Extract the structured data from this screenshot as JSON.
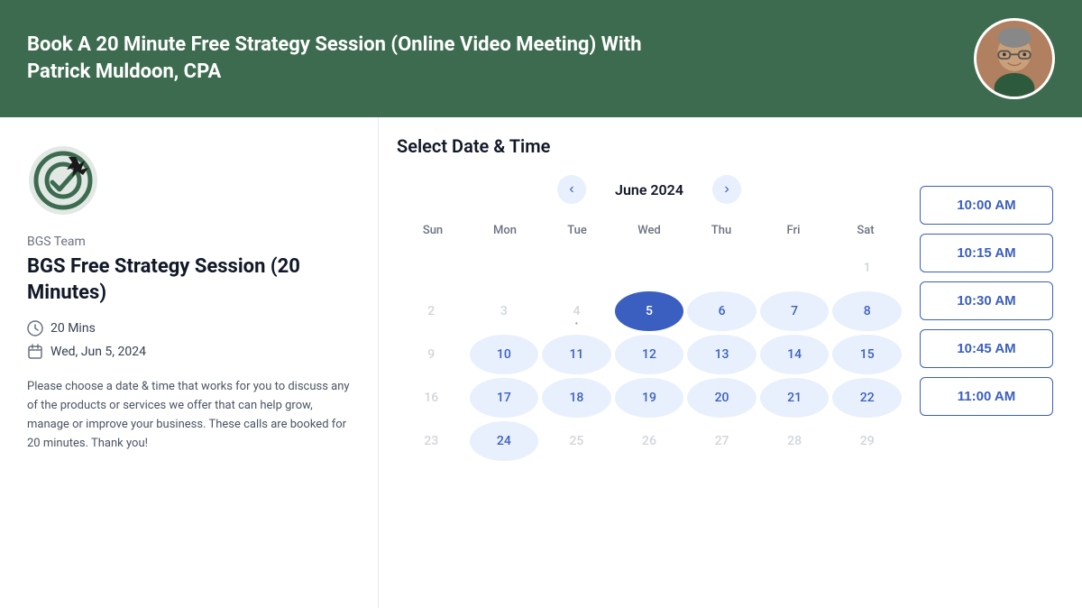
{
  "header": {
    "title": "Book A 20 Minute Free Strategy Session (Online Video Meeting) With Patrick Muldoon, CPA"
  },
  "left_panel": {
    "team_name": "BGS Team",
    "session_title": "BGS Free Strategy Session (20 Minutes)",
    "duration": "20 Mins",
    "selected_date": "Wed, Jun 5, 2024",
    "description": "Please choose a date & time that works for you to discuss any of the products or services we offer that can help grow, manage or improve your business. These calls are booked for 20 minutes. Thank you!"
  },
  "calendar": {
    "section_title": "Select Date & Time",
    "month_label": "June 2024",
    "day_headers": [
      "Sun",
      "Mon",
      "Tue",
      "Wed",
      "Thu",
      "Fri",
      "Sat"
    ],
    "weeks": [
      [
        {
          "label": "",
          "state": "empty"
        },
        {
          "label": "",
          "state": "empty"
        },
        {
          "label": "",
          "state": "empty"
        },
        {
          "label": "",
          "state": "empty"
        },
        {
          "label": "",
          "state": "empty"
        },
        {
          "label": "",
          "state": "empty"
        },
        {
          "label": "1",
          "state": "disabled"
        }
      ],
      [
        {
          "label": "2",
          "state": "disabled"
        },
        {
          "label": "3",
          "state": "disabled"
        },
        {
          "label": "4",
          "state": "has-dot disabled"
        },
        {
          "label": "5",
          "state": "selected"
        },
        {
          "label": "6",
          "state": "available"
        },
        {
          "label": "7",
          "state": "available"
        },
        {
          "label": "8",
          "state": "available"
        }
      ],
      [
        {
          "label": "9",
          "state": "disabled"
        },
        {
          "label": "10",
          "state": "available"
        },
        {
          "label": "11",
          "state": "available"
        },
        {
          "label": "12",
          "state": "available"
        },
        {
          "label": "13",
          "state": "available"
        },
        {
          "label": "14",
          "state": "available"
        },
        {
          "label": "15",
          "state": "available"
        }
      ],
      [
        {
          "label": "16",
          "state": "disabled"
        },
        {
          "label": "17",
          "state": "available"
        },
        {
          "label": "18",
          "state": "available"
        },
        {
          "label": "19",
          "state": "available"
        },
        {
          "label": "20",
          "state": "available"
        },
        {
          "label": "21",
          "state": "available"
        },
        {
          "label": "22",
          "state": "available"
        }
      ],
      [
        {
          "label": "23",
          "state": "disabled"
        },
        {
          "label": "24",
          "state": "available"
        },
        {
          "label": "25",
          "state": "disabled"
        },
        {
          "label": "26",
          "state": "disabled"
        },
        {
          "label": "27",
          "state": "disabled"
        },
        {
          "label": "28",
          "state": "disabled"
        },
        {
          "label": "29",
          "state": "disabled"
        }
      ]
    ]
  },
  "time_slots": [
    "10:00 AM",
    "10:15 AM",
    "10:30 AM",
    "10:45 AM",
    "11:00 AM"
  ],
  "nav": {
    "prev_label": "‹",
    "next_label": "›"
  }
}
